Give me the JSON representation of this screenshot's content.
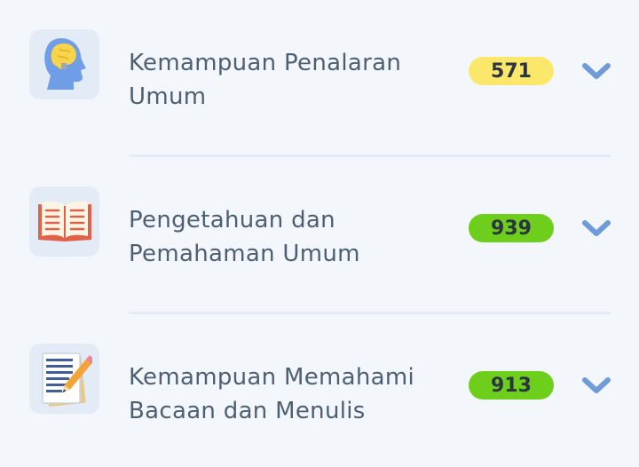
{
  "items": [
    {
      "line1": "Kemampuan Penalaran",
      "line2": "Umum",
      "score": "571",
      "badge_color": "#fbe86a",
      "icon": "brain-head-icon"
    },
    {
      "line1": "Pengetahuan dan",
      "line2": "Pemahaman Umum",
      "score": "939",
      "badge_color": "#6dcf1c",
      "icon": "open-book-icon"
    },
    {
      "line1": "Kemampuan Memahami",
      "line2": "Bacaan dan Menulis",
      "score": "913",
      "badge_color": "#6dcf1c",
      "icon": "document-pencil-icon"
    }
  ],
  "colors": {
    "icon_bg": "#e3ebf6",
    "text": "#4d5f73",
    "chevron": "#6f9bd8",
    "divider": "#e6ebf3"
  }
}
